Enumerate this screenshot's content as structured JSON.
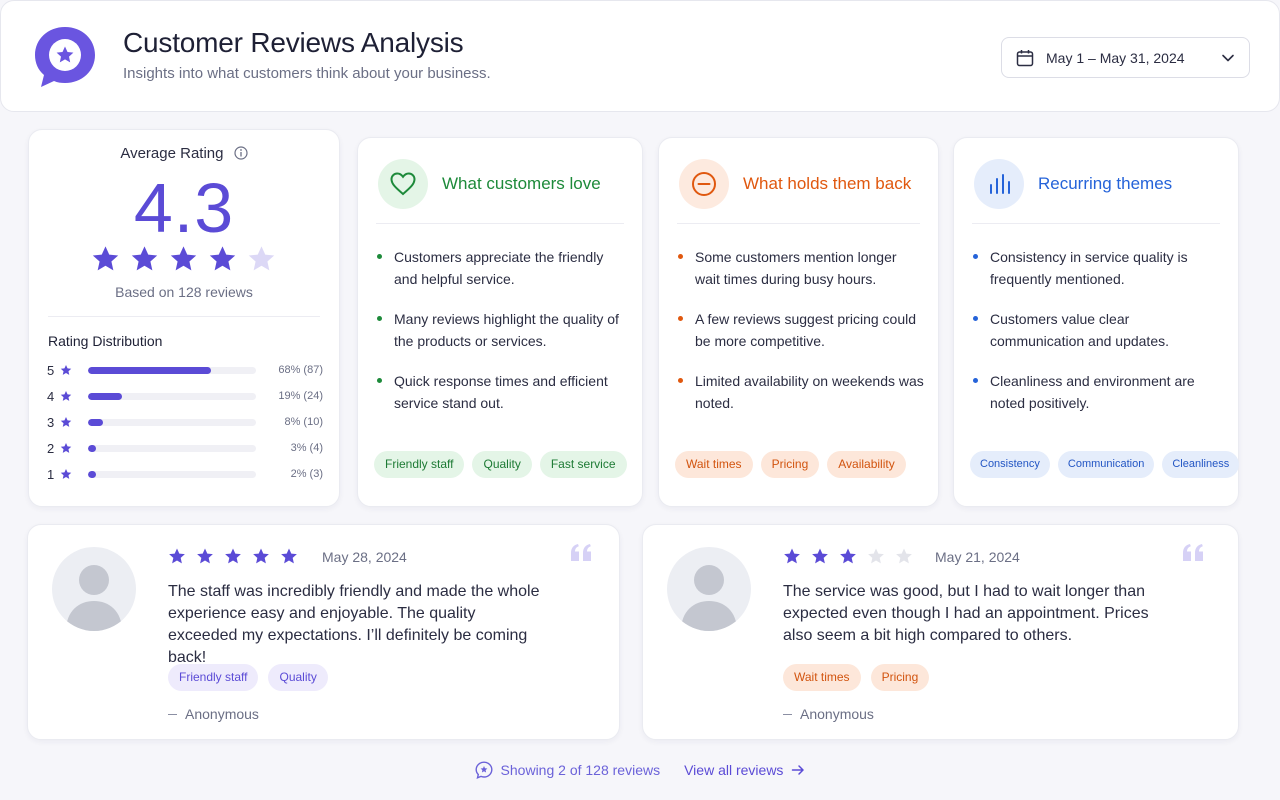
{
  "header": {
    "title": "Customer Reviews Analysis",
    "subtitle": "Insights into what customers think about your business.",
    "date_range": "May 1 – May 31, 2024",
    "logo_icon": "chat-star-icon"
  },
  "colors": {
    "accent": "#5b4bd6",
    "green": "#1d8a3a",
    "orange": "#e0580f",
    "blue": "#2563d9"
  },
  "rating": {
    "label": "Average Rating",
    "value": "4.3",
    "stars_filled": 4,
    "stars_total": 5,
    "based_on": "Based on 128 reviews",
    "distribution_title": "Rating Distribution",
    "distribution": [
      {
        "star": "5",
        "fraction": 0.68,
        "label": "68% (87)"
      },
      {
        "star": "4",
        "fraction": 0.19,
        "label": "19% (24)"
      },
      {
        "star": "3",
        "fraction": 0.08,
        "label": "8% (10)"
      },
      {
        "star": "2",
        "fraction": 0.03,
        "label": "3% (4)"
      },
      {
        "star": "1",
        "fraction": 0.02,
        "label": "2% (3)"
      }
    ]
  },
  "love": {
    "title": "What customers love",
    "icon": "heart-icon",
    "items": [
      "Customers appreciate the friendly and helpful service.",
      "Many reviews highlight the quality of the products or services.",
      "Quick response times and efficient service stand out."
    ],
    "tags": [
      "Friendly staff",
      "Quality",
      "Fast service"
    ]
  },
  "back": {
    "title": "What holds them back",
    "icon": "minus-circle-icon",
    "items": [
      "Some customers mention longer wait times during busy hours.",
      "A few reviews suggest pricing could be more competitive.",
      "Limited availability on weekends was noted."
    ],
    "tags": [
      "Wait times",
      "Pricing",
      "Availability"
    ]
  },
  "themes": {
    "title": "Recurring themes",
    "icon": "bar-chart-icon",
    "items": [
      "Consistency in service quality is frequently mentioned.",
      "Customers value clear communication and updates.",
      "Cleanliness and environment are noted positively."
    ],
    "tags": [
      "Consistency",
      "Communication",
      "Cleanliness"
    ]
  },
  "reviews": [
    {
      "stars_filled": 5,
      "date": "May 28, 2024",
      "text": "The staff was incredibly friendly and made the whole experience easy and enjoyable. The quality exceeded my expectations. I’ll definitely be coming back!",
      "tags": [
        "Friendly staff",
        "Quality"
      ],
      "author": "Anonymous"
    },
    {
      "stars_filled": 3,
      "date": "May 21, 2024",
      "text": "The service was good, but I had to wait longer than expected even though I had an appointment. Prices also seem a bit high compared to others.",
      "tags": [
        "Wait times",
        "Pricing"
      ],
      "author": "Anonymous"
    }
  ],
  "footer": {
    "showing": "Showing 2 of 128 reviews",
    "view_all": "View all reviews"
  }
}
